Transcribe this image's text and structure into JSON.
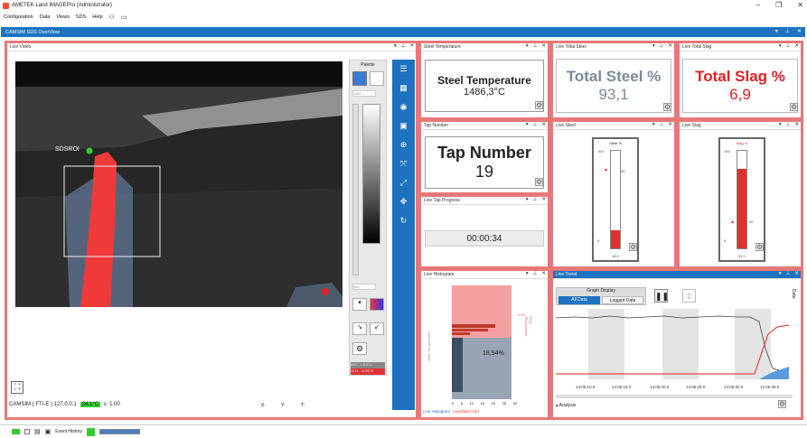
{
  "window": {
    "title": "AMETEK Land IMAGEPro (Administrator)"
  },
  "menu": [
    "Configuration",
    "Data",
    "Views",
    "SDS",
    "Help"
  ],
  "overview": {
    "title": "CAMSIM SDS OverView"
  },
  "live_video": {
    "title": "Live Video",
    "roi_label": "SDSROI",
    "palette_title": "Palette",
    "palette_top": "1060",
    "palette_bottom": "254",
    "range_1": "800 - 1310°C",
    "range_2": "1311 - 2020°C",
    "footer_source": "CAMSIM ( FTI-E ) 127.0.0.1",
    "footer_temp": "34,1°C",
    "footer_eps": "ε: 1.00",
    "footer_x": "X:",
    "footer_y": "Y:",
    "footer_t": "T:"
  },
  "steel_temp": {
    "header": "Steel Temperature",
    "title": "Steel Temperature",
    "value": "1486,3°C"
  },
  "tap_number": {
    "header": "Tap Number",
    "title": "Tap Number",
    "value": "19"
  },
  "tap_progress": {
    "header": "Live Tap Progress",
    "value": "00:00:34"
  },
  "total_steel": {
    "header": "Live Total Steel",
    "title": "Total Steel %",
    "value": "93,1"
  },
  "total_slag": {
    "header": "Live Total Slag",
    "title": "Total Slag %",
    "value": "6,9"
  },
  "live_steel": {
    "header": "Live Steel",
    "thermo_title": "Steel %",
    "top": "100",
    "mid": "90",
    "bottom": "0",
    "value": "18,9",
    "fill": 0.189,
    "color": "#e03030"
  },
  "live_slag": {
    "header": "Live Slag",
    "thermo_title": "Slag %",
    "top": "100",
    "mid": "20",
    "bottom": "0",
    "value": "81,1",
    "fill": 0.811,
    "color": "#e03030"
  },
  "histogram": {
    "header": "Live Histogram",
    "left_label": "Steel Temperature",
    "right_label": "Slag Temperature",
    "percent": "18,94%",
    "marker": "1079",
    "xticks": [
      "0",
      "5",
      "10",
      "15",
      "20",
      "25",
      "30"
    ],
    "tab1": "Live Histogram",
    "tab2": "UserData Grid"
  },
  "trend": {
    "header": "Live Trend",
    "graph_display": "Graph Display",
    "btn_all": "All Data",
    "btn_logged": "Logged Data",
    "times": [
      "14:06:10.0",
      "14:06:15.0",
      "14:06:20.0",
      "14:06:25.0",
      "14:06:30.0",
      "14:06:35.0"
    ],
    "analysis": "Analysis",
    "data_tab": "Data"
  },
  "statusbar": {
    "event_history": "Event History"
  }
}
